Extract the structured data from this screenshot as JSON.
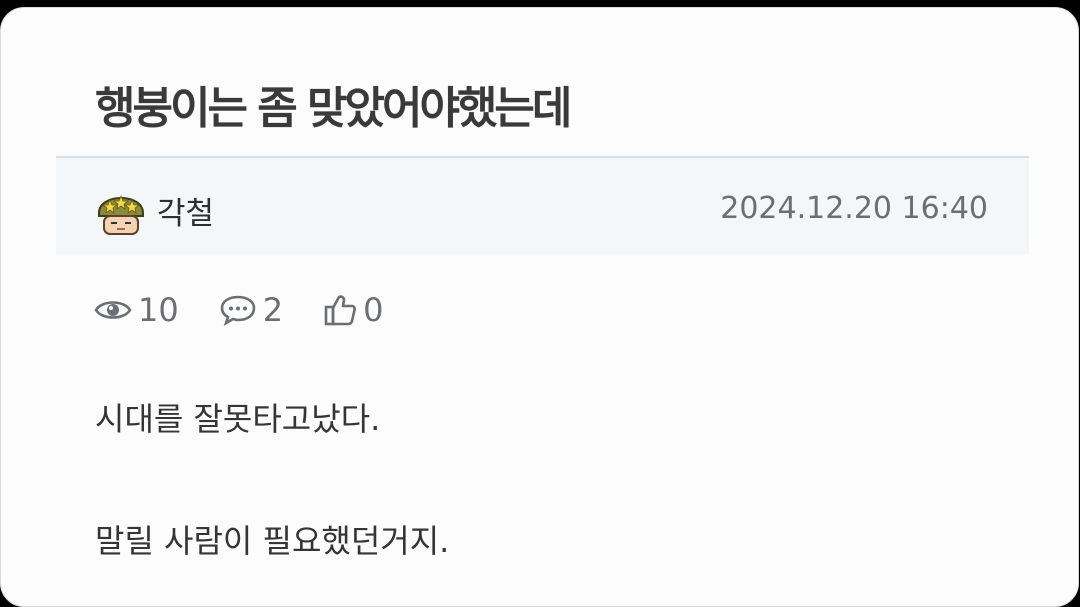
{
  "post": {
    "title": "행붕이는 좀 맞았어야했는데",
    "author": "각철",
    "date": "2024.12.20 16:40",
    "stats": {
      "views": "10",
      "comments": "2",
      "likes": "0"
    },
    "body": [
      "시대를 잘못타고났다.",
      "말릴 사람이 필요했던거지."
    ]
  },
  "icons": {
    "views": "eye-icon",
    "comments": "comment-icon",
    "likes": "thumbs-up-icon",
    "avatar": "soldier-helmet-avatar"
  },
  "colors": {
    "background": "#fcfcfd",
    "meta_bar": "#f5f6f8",
    "text_muted": "#6b6e73",
    "title": "#3a3a3a"
  }
}
